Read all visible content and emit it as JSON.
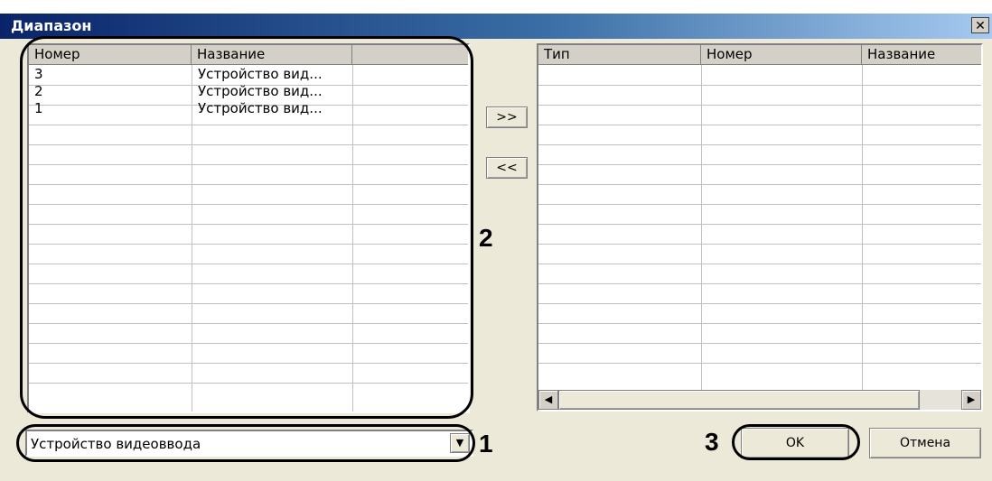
{
  "window": {
    "title": "Диапазон",
    "close_glyph": "✕"
  },
  "left_list": {
    "columns": [
      "Номер",
      "Название",
      ""
    ],
    "rows": [
      {
        "number": "3",
        "name": "Устройство вид..."
      },
      {
        "number": "2",
        "name": "Устройство вид..."
      },
      {
        "number": "1",
        "name": "Устройство вид..."
      }
    ]
  },
  "transfer": {
    "add_label": ">>",
    "remove_label": "<<"
  },
  "right_list": {
    "columns": [
      "Тип",
      "Номер",
      "Название"
    ]
  },
  "scrollbar": {
    "left_arrow": "◀",
    "right_arrow": "▶"
  },
  "device_type_select": {
    "value": "Устройство видеоввода",
    "arrow": "▼"
  },
  "buttons": {
    "ok_label": "OK",
    "cancel_label": "Отмена"
  },
  "annotations": {
    "a1": "1",
    "a2": "2",
    "a3": "3"
  }
}
